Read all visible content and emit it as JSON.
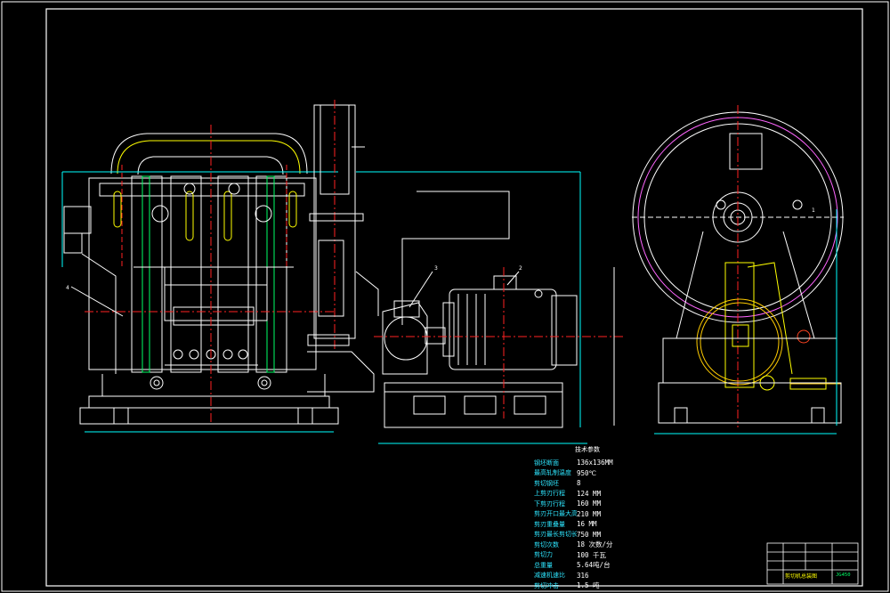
{
  "drawing": {
    "spec_table": {
      "title": "技术参数",
      "rows": [
        {
          "label": "钢坯断面",
          "value": "136x136MM"
        },
        {
          "label": "最高轧制温度",
          "value": "950℃"
        },
        {
          "label": "剪切钢坯",
          "value": "8"
        },
        {
          "label": "上剪刃行程",
          "value": "124 MM"
        },
        {
          "label": "下剪刃行程",
          "value": "160 MM"
        },
        {
          "label": "剪刃开口最大高度",
          "value": "210 MM"
        },
        {
          "label": "剪刃重叠量",
          "value": "16 MM"
        },
        {
          "label": "剪刃最长剪切长度",
          "value": "750 MM"
        },
        {
          "label": "剪切次数",
          "value": "18 次数/分"
        },
        {
          "label": "剪切力",
          "value": "100 千瓦"
        },
        {
          "label": "总重量",
          "value": "5.64吨/台"
        },
        {
          "label": "减速机速比",
          "value": "316"
        },
        {
          "label": "剪切冲击",
          "value": "1.5 吨"
        }
      ]
    },
    "title_block": {
      "name": "剪切机总装图",
      "code": "JG450"
    },
    "part_labels": [
      "4",
      "3",
      "2",
      "1"
    ]
  }
}
